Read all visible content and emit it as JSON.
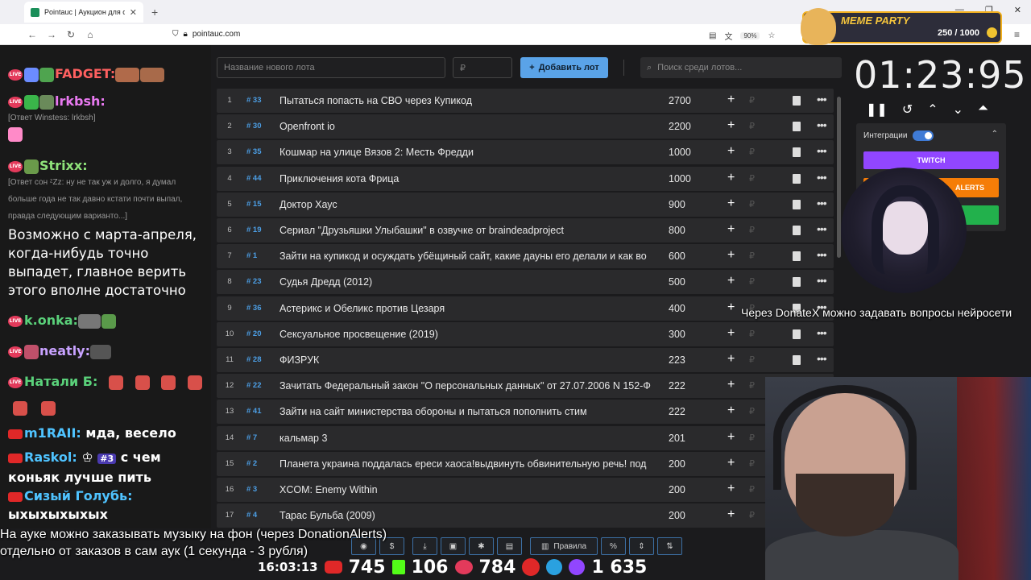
{
  "browser": {
    "tab_title": "Pointauc | Аукцион для стрима",
    "url": "pointauc.com",
    "zoom": "90%"
  },
  "meme_banner": {
    "title": "MEME PARTY",
    "count": "250 / 1000"
  },
  "chat": {
    "lines": [
      {
        "user": "FADGET:",
        "color": "#ff6060",
        "text": ""
      },
      {
        "user": "lrkbsh:",
        "color": "#e879f0",
        "text": ""
      },
      {
        "user": "Strixx:",
        "color": "#8fe37a",
        "text": ""
      },
      {
        "user": "k.onka:",
        "color": "#5ad17a",
        "text": ""
      },
      {
        "user": "neatly:",
        "color": "#c8a2ff",
        "text": ""
      },
      {
        "user": "Натали Б:",
        "color": "#5ad17a",
        "text": ""
      },
      {
        "user": "m1RAII:",
        "color": "#4fc3ff",
        "text": "мда, весело"
      },
      {
        "user": "Raskol:",
        "color": "#4fc3ff",
        "text": "с чем коньяк лучше пить"
      },
      {
        "user": "Сизый Голубь:",
        "color": "#4fc3ff",
        "text": "ыхыхыхыхых"
      }
    ],
    "reply1": "[Ответ Winstess: lrkbsh]",
    "reply2": "[Ответ сон ᶻZz: ну не так уж и долго, я думал больше года не так давно кстати почти выпал, правда следующим варианто...]",
    "big_message": "Возможно с марта-апреля, когда-нибудь точно выпадет, главное верить этого вполне достаточно",
    "raskol_badge": "#3"
  },
  "toolbar": {
    "lot_placeholder": "Название нового лота",
    "price_placeholder": "₽",
    "add_label": "Добавить лот",
    "search_placeholder": "Поиск среди лотов..."
  },
  "lots": [
    {
      "n": "1",
      "id": "# 33",
      "name": "Пытаться попасть на СВО через Купикод",
      "amount": "2700"
    },
    {
      "n": "2",
      "id": "# 30",
      "name": "Openfront io",
      "amount": "2200"
    },
    {
      "n": "3",
      "id": "# 35",
      "name": "Кошмар на улице Вязов 2: Месть Фредди",
      "amount": "1000"
    },
    {
      "n": "4",
      "id": "# 44",
      "name": "Приключения кота Фрица",
      "amount": "1000"
    },
    {
      "n": "5",
      "id": "# 15",
      "name": "Доктор Хаус",
      "amount": "900"
    },
    {
      "n": "6",
      "id": "# 19",
      "name": "Сериал \"Друзьяшки Улыбашки\" в озвучке от braindeadproject",
      "amount": "800"
    },
    {
      "n": "7",
      "id": "# 1",
      "name": "Зайти на купикод и осуждать убёщиный сайт, какие дауны его делали и как во",
      "amount": "600"
    },
    {
      "n": "8",
      "id": "# 23",
      "name": "Судья Дредд (2012)",
      "amount": "500"
    },
    {
      "n": "9",
      "id": "# 36",
      "name": "Астерикс и Обеликс против Цезаря",
      "amount": "400"
    },
    {
      "n": "10",
      "id": "# 20",
      "name": "Сексуальное просвещение (2019)",
      "amount": "300"
    },
    {
      "n": "11",
      "id": "# 28",
      "name": "ФИЗРУК",
      "amount": "223"
    },
    {
      "n": "12",
      "id": "# 22",
      "name": "Зачитать Федеральный закон \"О персональных данных\" от 27.07.2006 N 152-Ф",
      "amount": "222"
    },
    {
      "n": "13",
      "id": "# 41",
      "name": "Зайти на сайт министерства обороны и пытаться пополнить стим",
      "amount": "222"
    },
    {
      "n": "14",
      "id": "# 7",
      "name": "кальмар 3",
      "amount": "201"
    },
    {
      "n": "15",
      "id": "# 2",
      "name": "Планета украина поддалась ереси хаоса!выдвинуть обвинительную речь! под",
      "amount": "200"
    },
    {
      "n": "16",
      "id": "# 3",
      "name": "XCOM: Enemy Within",
      "amount": "200"
    },
    {
      "n": "17",
      "id": "# 4",
      "name": "Тарас Бульба (2009)",
      "amount": "200"
    }
  ],
  "bottom_toolbar": {
    "rules_label": "Правила",
    "percent_label": "%"
  },
  "timer": {
    "value": "01:23:95"
  },
  "integrations": {
    "label": "Интеграции",
    "twitch_label": "TWITCH",
    "alerts_label": "ALERTS"
  },
  "overlay": {
    "donatex_text": "Через DonateX можно задавать вопросы нейросети",
    "music_line1": "На ауке можно заказывать музыку на фон (через DonationAlerts)",
    "music_line2": "отдельно от заказов в сам аук (1 секунда - 3 рубля)"
  },
  "stats": {
    "clock": "16:03:13",
    "youtube": "745",
    "kick": "106",
    "live": "784",
    "telegram": "1 635"
  },
  "colors": {
    "accent": "#5aa3e8",
    "lot_id": "#4c9fe6",
    "twitch": "#9146ff",
    "alerts": "#f57d07",
    "green": "#22b14c"
  }
}
